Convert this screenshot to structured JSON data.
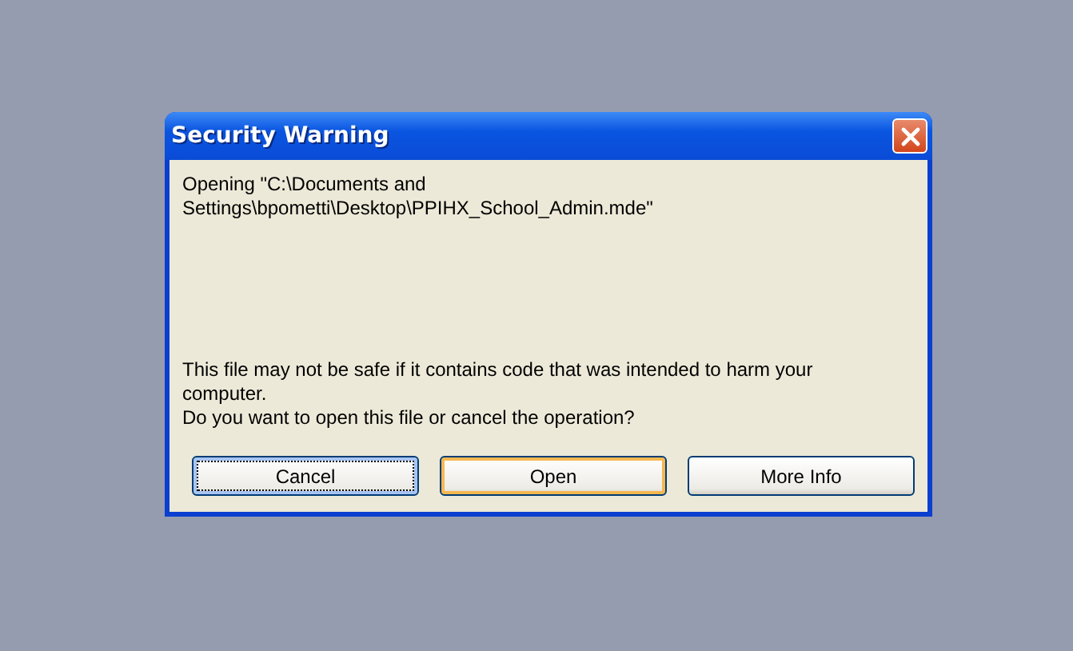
{
  "window": {
    "title": "Security Warning"
  },
  "message": {
    "opening": "Opening \"C:\\Documents and Settings\\bpometti\\Desktop\\PPIHX_School_Admin.mde\"",
    "warning": [
      "This file may not be safe if it contains code that was intended to harm your computer.",
      "Do you want to open this file or cancel the operation?"
    ]
  },
  "buttons": [
    {
      "label": "Cancel",
      "focused": true,
      "default": false
    },
    {
      "label": "Open",
      "focused": false,
      "default": true
    },
    {
      "label": "More Info",
      "focused": false,
      "default": false
    }
  ]
}
